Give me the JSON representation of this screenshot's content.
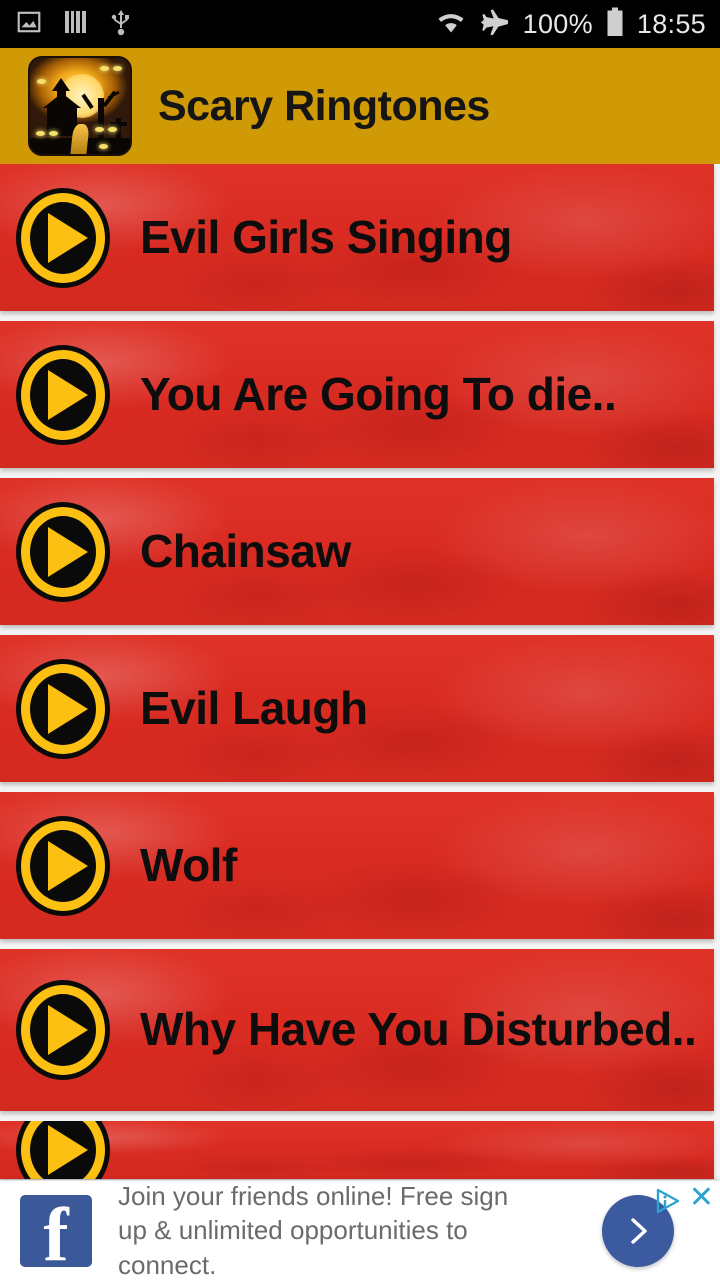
{
  "statusbar": {
    "icons_left": [
      "image-icon",
      "bars-icon",
      "usb-icon"
    ],
    "icons_right": [
      "wifi-icon",
      "airplane-icon",
      "battery-icon"
    ],
    "battery_label": "100%",
    "clock": "18:55"
  },
  "appbar": {
    "title": "Scary Ringtones",
    "icon_name": "app-logo-haunted-house",
    "background_color": "#cf9a05"
  },
  "list": {
    "accent_color": "#fcc013",
    "row_color": "#d92b22",
    "items": [
      {
        "label": "Evil Girls Singing",
        "play_icon": "play-icon",
        "lines": 1
      },
      {
        "label": "You Are Going To die..",
        "play_icon": "play-icon",
        "lines": 1
      },
      {
        "label": "Chainsaw",
        "play_icon": "play-icon",
        "lines": 1
      },
      {
        "label": "Evil Laugh",
        "play_icon": "play-icon",
        "lines": 1
      },
      {
        "label": "Wolf",
        "play_icon": "play-icon",
        "lines": 1
      },
      {
        "label": "Why Have You Disturbed..",
        "play_icon": "play-icon",
        "lines": 2
      },
      {
        "label": "",
        "play_icon": "play-icon",
        "lines": 1
      }
    ]
  },
  "ad": {
    "advertiser_icon": "facebook-logo",
    "advertiser_letter": "f",
    "text": "Join your friends online! Free sign up & unlimited opportunities to connect.",
    "cta_icon": "chevron-right-icon",
    "adchoices_icon": "adchoices-icon",
    "close_label": "✕",
    "brand_color": "#3b5998"
  }
}
